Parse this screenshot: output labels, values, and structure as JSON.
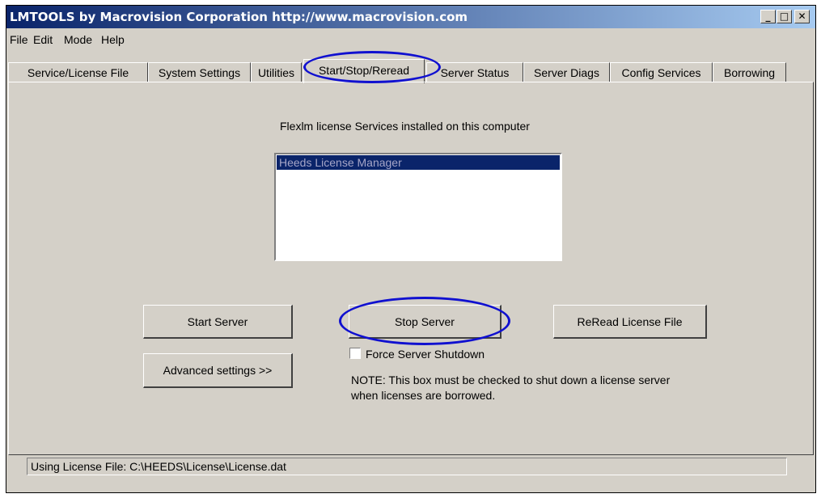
{
  "window": {
    "title": "LMTOOLS by Macrovision Corporation http://www.macrovision.com",
    "controls": {
      "minimize": "_",
      "maximize": "□",
      "close": "✕"
    }
  },
  "menu": [
    "File",
    "Edit",
    "Mode",
    "Help"
  ],
  "tabs": [
    "Service/License File",
    "System Settings",
    "Utilities",
    "Start/Stop/Reread",
    "Server Status",
    "Server Diags",
    "Config Services",
    "Borrowing"
  ],
  "active_tab": "Start/Stop/Reread",
  "panel": {
    "services_heading": "Flexlm license Services installed on this computer",
    "services": [
      "Heeds License Manager"
    ],
    "start_button": "Start Server",
    "stop_button": "Stop Server",
    "reread_button": "ReRead License File",
    "advanced_button": "Advanced settings >>",
    "force_shutdown_label": "Force Server Shutdown",
    "force_shutdown_checked": false,
    "note_line1": "NOTE:  This box must be checked to shut down a license server",
    "note_line2": "when licenses are borrowed."
  },
  "status": {
    "text": "Using License File:  C:\\HEEDS\\License\\License.dat"
  },
  "colors": {
    "title_bar": "#0a246a",
    "annotation": "#1010d0",
    "face": "#d4d0c8"
  }
}
